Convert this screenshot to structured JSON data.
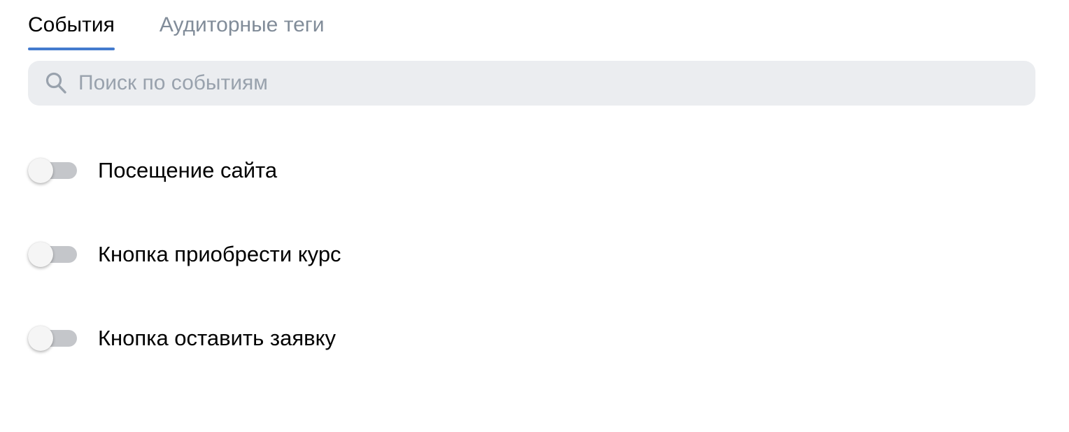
{
  "tabs": [
    {
      "label": "События",
      "active": true
    },
    {
      "label": "Аудиторные теги",
      "active": false
    }
  ],
  "search": {
    "placeholder": "Поиск по событиям",
    "value": ""
  },
  "events": [
    {
      "label": "Посещение сайта",
      "enabled": false
    },
    {
      "label": "Кнопка приобрести курс",
      "enabled": false
    },
    {
      "label": "Кнопка оставить заявку",
      "enabled": false
    }
  ],
  "colors": {
    "accent": "#447bce",
    "tab_inactive": "#818c99",
    "search_bg": "#ebedf0",
    "toggle_track_off": "#c4c6ca"
  }
}
